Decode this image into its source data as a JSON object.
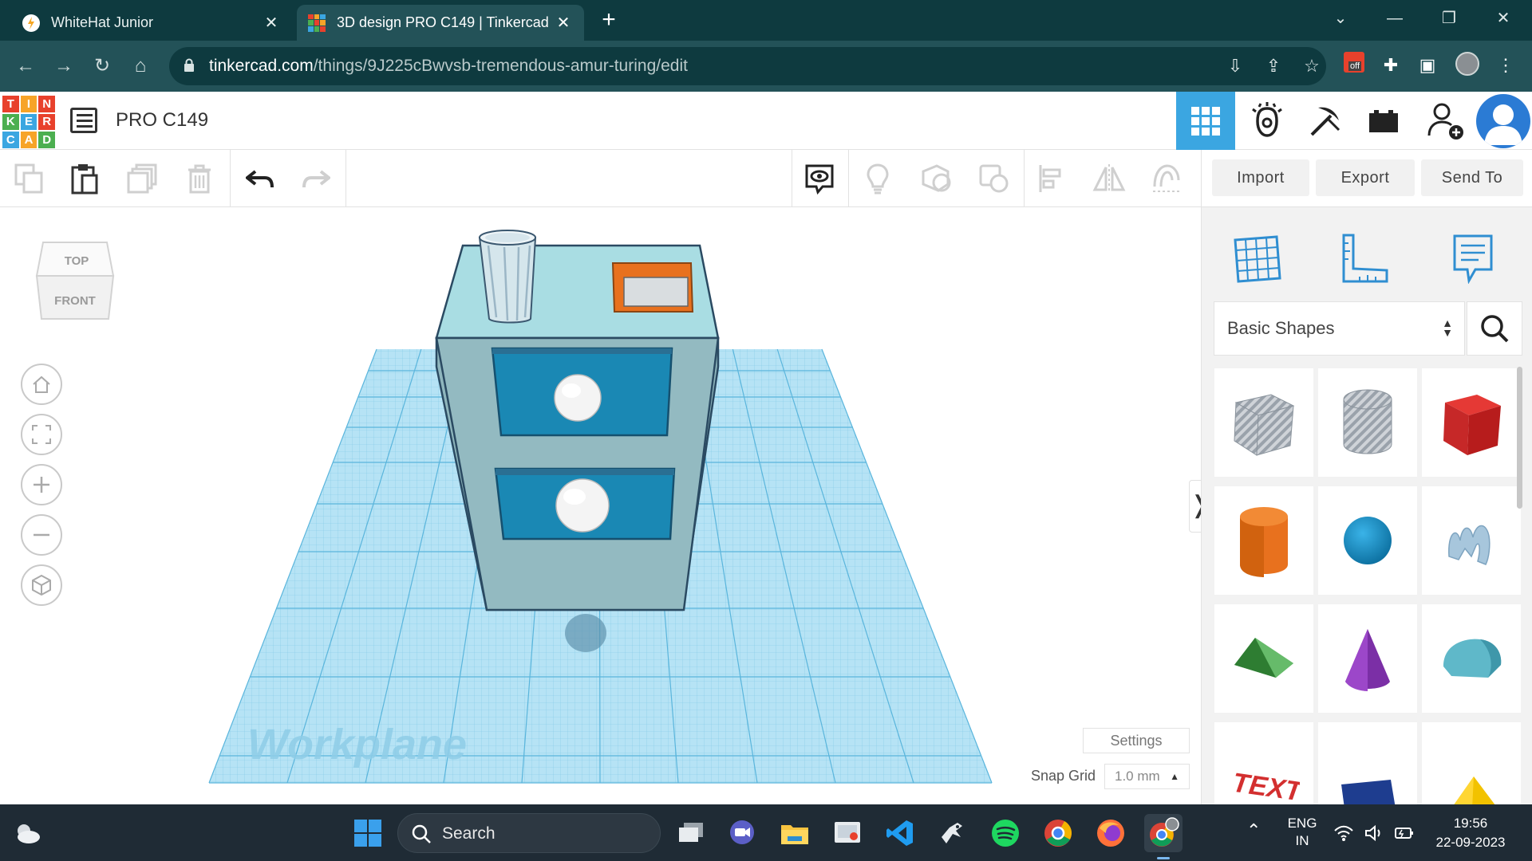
{
  "browser": {
    "tabs": [
      {
        "title": "WhiteHat Junior",
        "icon": "whitehat-icon",
        "active": false
      },
      {
        "title": "3D design PRO C149 | Tinkercad",
        "icon": "tinkercad-icon",
        "active": true
      }
    ],
    "url_domain": "tinkercad.com",
    "url_path": "/things/9J225cBwvsb-tremendous-amur-turing/edit",
    "extension_badge": "off"
  },
  "app": {
    "logo_letters": [
      "T",
      "I",
      "N",
      "K",
      "E",
      "R",
      "C",
      "A",
      "D"
    ],
    "design_title": "PRO C149"
  },
  "toolbar": {
    "import_label": "Import",
    "export_label": "Export",
    "send_to_label": "Send To"
  },
  "viewport": {
    "viewcube_top": "TOP",
    "viewcube_front": "FRONT",
    "workplane_label": "Workplane",
    "settings_label": "Settings",
    "snap_grid_label": "Snap Grid",
    "snap_grid_value": "1.0 mm"
  },
  "panel": {
    "library_selected": "Basic Shapes",
    "shapes": [
      "box-hole",
      "cylinder-hole",
      "box",
      "cylinder",
      "sphere",
      "scribble",
      "roof",
      "cone",
      "round-roof",
      "text",
      "wedge",
      "pyramid"
    ]
  },
  "taskbar": {
    "search_placeholder": "Search",
    "lang_line1": "ENG",
    "lang_line2": "IN",
    "time": "19:56",
    "date": "22-09-2023"
  },
  "colors": {
    "tab_bar": "#0e3a3f",
    "address_bar": "#235258",
    "accent_blue": "#3ba6e1",
    "workplane": "#aee0f4",
    "cabinet": "#8fb6bd",
    "drawer": "#1a88b4"
  }
}
